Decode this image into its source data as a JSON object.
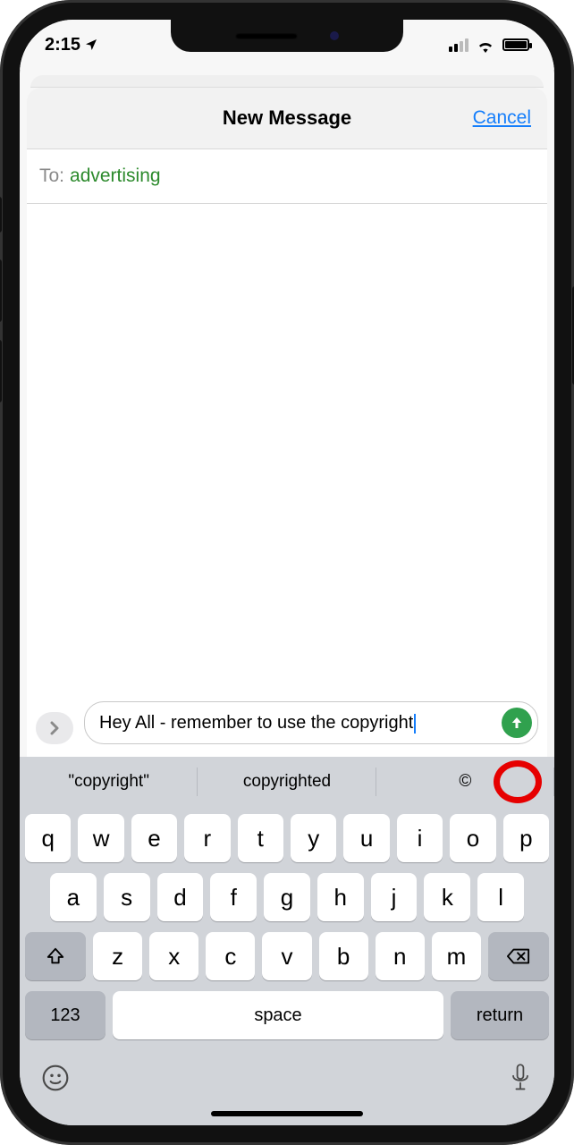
{
  "status": {
    "time": "2:15"
  },
  "header": {
    "title": "New Message",
    "cancel": "Cancel"
  },
  "compose": {
    "to_label": "To:",
    "to_value": "advertising",
    "message_text": "Hey All - remember to use the copyright"
  },
  "suggestions": {
    "s1": "\"copyright\"",
    "s2": "copyrighted",
    "s3": "©"
  },
  "keys": {
    "row1": [
      "q",
      "w",
      "e",
      "r",
      "t",
      "y",
      "u",
      "i",
      "o",
      "p"
    ],
    "row2": [
      "a",
      "s",
      "d",
      "f",
      "g",
      "h",
      "j",
      "k",
      "l"
    ],
    "row3": [
      "z",
      "x",
      "c",
      "v",
      "b",
      "n",
      "m"
    ],
    "numbers": "123",
    "space": "space",
    "return": "return"
  }
}
